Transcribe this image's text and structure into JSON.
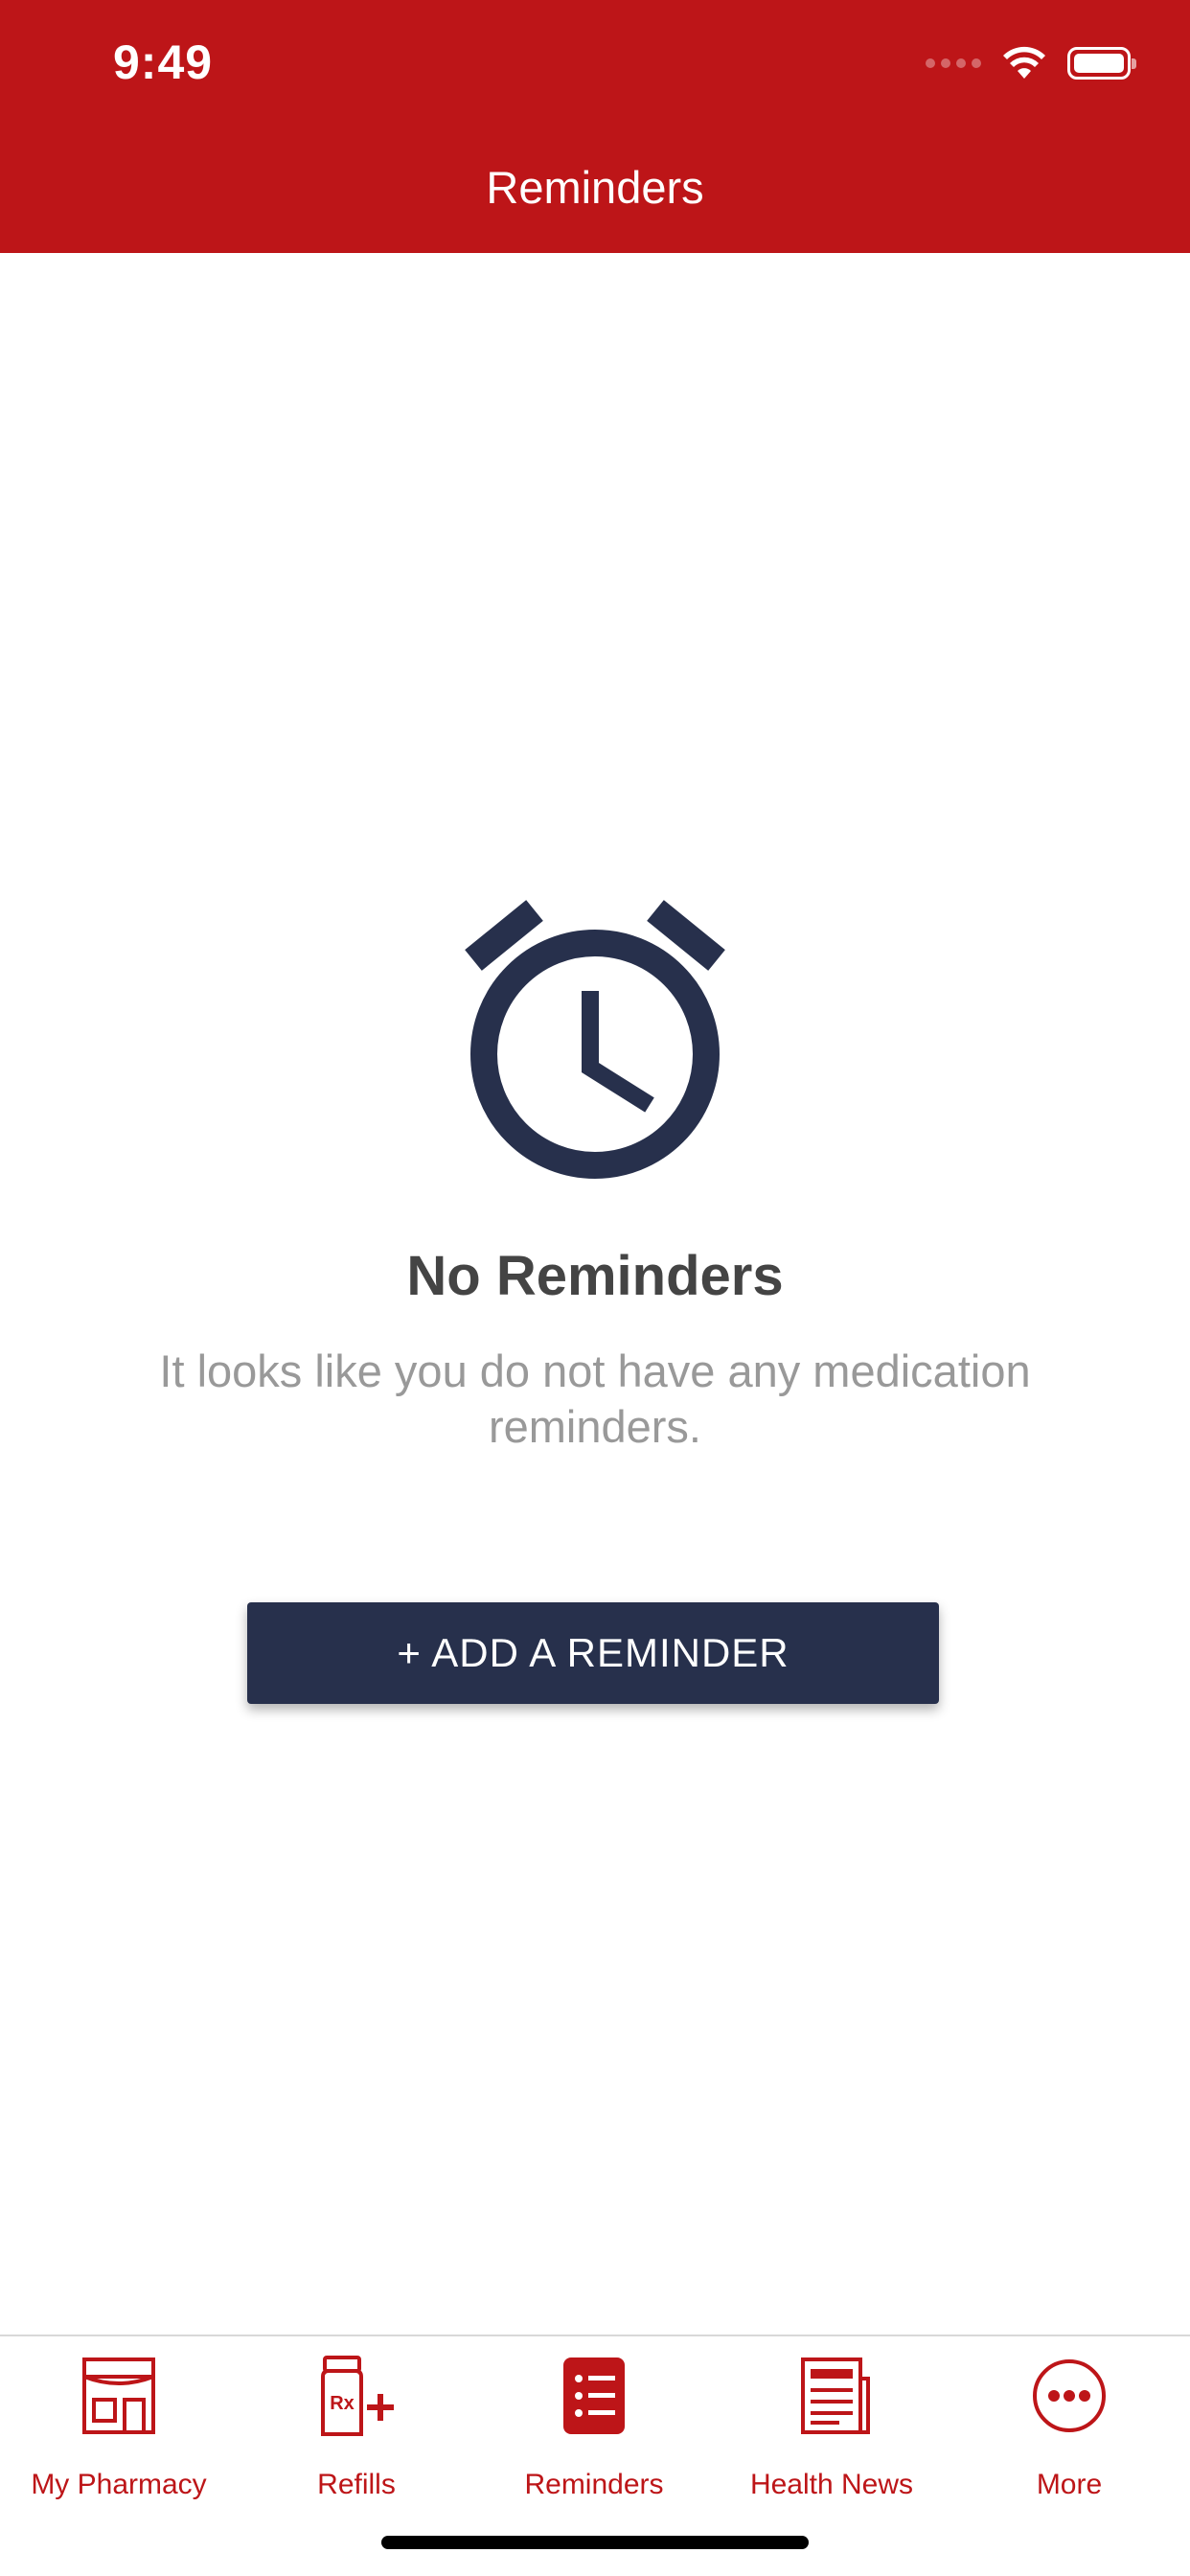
{
  "status_bar": {
    "time": "9:49"
  },
  "header": {
    "title": "Reminders",
    "background_color": "#bd1518"
  },
  "empty_state": {
    "icon": "alarm-clock-icon",
    "title": "No Reminders",
    "description": "It looks like you do not have any medication reminders.",
    "icon_color": "#27304c"
  },
  "add_button": {
    "label": "+ ADD A REMINDER",
    "color": "#27304c"
  },
  "tab_bar": {
    "accent_color": "#bd1518",
    "selected": "Reminders",
    "tabs": [
      {
        "label": "My Pharmacy",
        "icon": "storefront-icon"
      },
      {
        "label": "Refills",
        "icon": "rx-bottle-plus-icon"
      },
      {
        "label": "Reminders",
        "icon": "list-icon"
      },
      {
        "label": "Health News",
        "icon": "newspaper-icon"
      },
      {
        "label": "More",
        "icon": "ellipsis-circle-icon"
      }
    ]
  }
}
